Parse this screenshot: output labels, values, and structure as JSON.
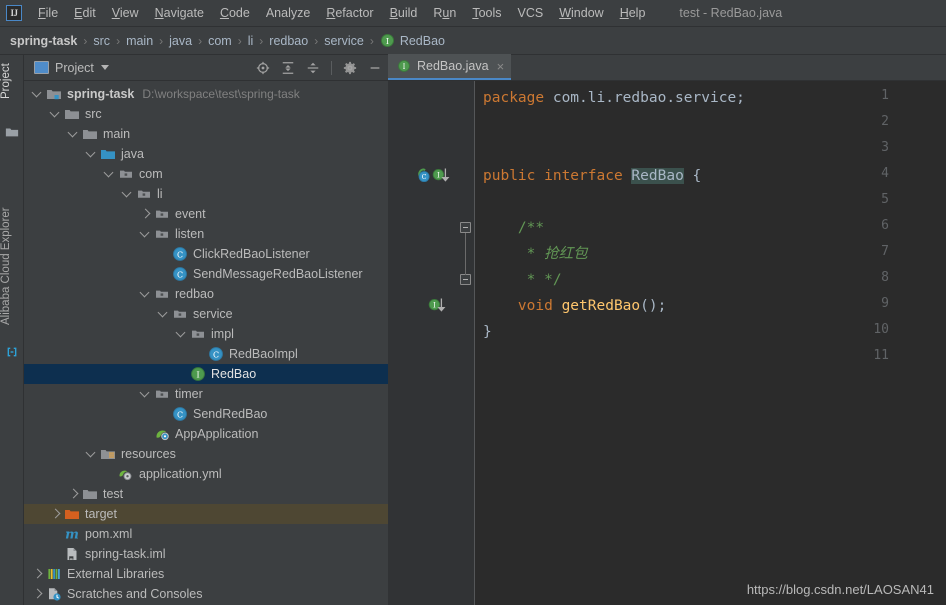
{
  "window": {
    "title": "test - RedBao.java",
    "logo_text": "IJ"
  },
  "menubar": {
    "items": [
      {
        "label": "File",
        "mnemonic": "F"
      },
      {
        "label": "Edit",
        "mnemonic": "E"
      },
      {
        "label": "View",
        "mnemonic": "V"
      },
      {
        "label": "Navigate",
        "mnemonic": "N"
      },
      {
        "label": "Code",
        "mnemonic": "C"
      },
      {
        "label": "Analyze",
        "mnemonic": ""
      },
      {
        "label": "Refactor",
        "mnemonic": "R"
      },
      {
        "label": "Build",
        "mnemonic": "B"
      },
      {
        "label": "Run",
        "mnemonic": "u"
      },
      {
        "label": "Tools",
        "mnemonic": "T"
      },
      {
        "label": "VCS",
        "mnemonic": ""
      },
      {
        "label": "Window",
        "mnemonic": "W"
      },
      {
        "label": "Help",
        "mnemonic": "H"
      }
    ]
  },
  "breadcrumb": {
    "separator": "›",
    "items": [
      {
        "label": "spring-task",
        "icon": "none",
        "root": true
      },
      {
        "label": "src",
        "icon": "none"
      },
      {
        "label": "main",
        "icon": "none"
      },
      {
        "label": "java",
        "icon": "none"
      },
      {
        "label": "com",
        "icon": "none"
      },
      {
        "label": "li",
        "icon": "none"
      },
      {
        "label": "redbao",
        "icon": "none"
      },
      {
        "label": "service",
        "icon": "none"
      },
      {
        "label": "RedBao",
        "icon": "interface-icon"
      }
    ]
  },
  "leftbar": {
    "tabs": [
      {
        "label": "Project",
        "icon": "project-folder-icon",
        "active": true
      },
      {
        "label": "Alibaba Cloud Explorer",
        "icon": "alibaba-cloud-icon",
        "active": false
      }
    ]
  },
  "project_panel": {
    "title": "Project",
    "title_icon": "project-view-icon",
    "dropdown_icon": "chevron-down-icon",
    "toolbar": [
      {
        "name": "scroll-from-source-icon",
        "title": "Select Opened File"
      },
      {
        "name": "expand-all-icon",
        "title": "Expand All"
      },
      {
        "name": "collapse-all-icon",
        "title": "Collapse All"
      },
      {
        "name": "settings-gear-icon",
        "title": "Settings"
      },
      {
        "name": "hide-panel-icon",
        "title": "Hide"
      }
    ],
    "tree": [
      {
        "label": "spring-task",
        "sublabel": "D:\\workspace\\test\\spring-task",
        "depth": 0,
        "arrow": "open",
        "icon": "module-icon",
        "bold": true,
        "state": "normal"
      },
      {
        "label": "src",
        "sublabel": "",
        "depth": 1,
        "arrow": "open",
        "icon": "folder-icon",
        "bold": false,
        "state": "normal"
      },
      {
        "label": "main",
        "sublabel": "",
        "depth": 2,
        "arrow": "open",
        "icon": "folder-icon",
        "bold": false,
        "state": "normal"
      },
      {
        "label": "java",
        "sublabel": "",
        "depth": 3,
        "arrow": "open",
        "icon": "source-root-icon",
        "bold": false,
        "state": "normal"
      },
      {
        "label": "com",
        "sublabel": "",
        "depth": 4,
        "arrow": "open",
        "icon": "package-icon",
        "bold": false,
        "state": "normal"
      },
      {
        "label": "li",
        "sublabel": "",
        "depth": 5,
        "arrow": "open",
        "icon": "package-icon",
        "bold": false,
        "state": "normal"
      },
      {
        "label": "event",
        "sublabel": "",
        "depth": 6,
        "arrow": "closed",
        "icon": "package-icon",
        "bold": false,
        "state": "normal"
      },
      {
        "label": "listen",
        "sublabel": "",
        "depth": 6,
        "arrow": "open",
        "icon": "package-icon",
        "bold": false,
        "state": "normal"
      },
      {
        "label": "ClickRedBaoListener",
        "sublabel": "",
        "depth": 7,
        "arrow": "none",
        "icon": "class-icon",
        "bold": false,
        "state": "normal"
      },
      {
        "label": "SendMessageRedBaoListener",
        "sublabel": "",
        "depth": 7,
        "arrow": "none",
        "icon": "class-icon",
        "bold": false,
        "state": "normal"
      },
      {
        "label": "redbao",
        "sublabel": "",
        "depth": 6,
        "arrow": "open",
        "icon": "package-icon",
        "bold": false,
        "state": "normal"
      },
      {
        "label": "service",
        "sublabel": "",
        "depth": 7,
        "arrow": "open",
        "icon": "package-icon",
        "bold": false,
        "state": "normal"
      },
      {
        "label": "impl",
        "sublabel": "",
        "depth": 8,
        "arrow": "open",
        "icon": "package-icon",
        "bold": false,
        "state": "normal"
      },
      {
        "label": "RedBaoImpl",
        "sublabel": "",
        "depth": 9,
        "arrow": "none",
        "icon": "class-icon",
        "bold": false,
        "state": "normal"
      },
      {
        "label": "RedBao",
        "sublabel": "",
        "depth": 8,
        "arrow": "none",
        "icon": "interface-icon",
        "bold": false,
        "state": "selected"
      },
      {
        "label": "timer",
        "sublabel": "",
        "depth": 6,
        "arrow": "open",
        "icon": "package-icon",
        "bold": false,
        "state": "normal"
      },
      {
        "label": "SendRedBao",
        "sublabel": "",
        "depth": 7,
        "arrow": "none",
        "icon": "class-icon",
        "bold": false,
        "state": "normal"
      },
      {
        "label": "AppApplication",
        "sublabel": "",
        "depth": 6,
        "arrow": "none",
        "icon": "spring-class-icon",
        "bold": false,
        "state": "normal"
      },
      {
        "label": "resources",
        "sublabel": "",
        "depth": 3,
        "arrow": "open",
        "icon": "resource-root-icon",
        "bold": false,
        "state": "normal"
      },
      {
        "label": "application.yml",
        "sublabel": "",
        "depth": 4,
        "arrow": "none",
        "icon": "spring-yml-icon",
        "bold": false,
        "state": "normal"
      },
      {
        "label": "test",
        "sublabel": "",
        "depth": 2,
        "arrow": "closed",
        "icon": "folder-icon",
        "bold": false,
        "state": "normal"
      },
      {
        "label": "target",
        "sublabel": "",
        "depth": 1,
        "arrow": "closed",
        "icon": "excluded-folder-icon",
        "bold": false,
        "state": "excluded"
      },
      {
        "label": "pom.xml",
        "sublabel": "",
        "depth": 1,
        "arrow": "none",
        "icon": "maven-icon",
        "bold": false,
        "state": "normal"
      },
      {
        "label": "spring-task.iml",
        "sublabel": "",
        "depth": 1,
        "arrow": "none",
        "icon": "iml-icon",
        "bold": false,
        "state": "normal"
      },
      {
        "label": "External Libraries",
        "sublabel": "",
        "depth": 0,
        "arrow": "closed",
        "icon": "libraries-icon",
        "bold": false,
        "state": "normal"
      },
      {
        "label": "Scratches and Consoles",
        "sublabel": "",
        "depth": 0,
        "arrow": "closed",
        "icon": "scratches-icon",
        "bold": false,
        "state": "normal"
      }
    ]
  },
  "editor": {
    "tabs": [
      {
        "label": "RedBao.java",
        "icon": "interface-icon",
        "close_glyph": "×",
        "active": true
      }
    ],
    "line_numbers": [
      "1",
      "2",
      "3",
      "4",
      "5",
      "6",
      "7",
      "8",
      "9",
      "10",
      "11"
    ],
    "lines": [
      {
        "n": "1",
        "tokens": [
          {
            "t": "package ",
            "c": "kw"
          },
          {
            "t": "com.li.redbao.service;",
            "c": "pn"
          }
        ]
      },
      {
        "n": "2",
        "tokens": []
      },
      {
        "n": "3",
        "tokens": []
      },
      {
        "n": "4",
        "tokens": [
          {
            "t": "public ",
            "c": "kw"
          },
          {
            "t": "interface ",
            "c": "kw"
          },
          {
            "t": "RedBao",
            "c": "hl"
          },
          {
            "t": " {",
            "c": "pn"
          }
        ]
      },
      {
        "n": "5",
        "tokens": []
      },
      {
        "n": "6",
        "tokens": [
          {
            "t": "    /**",
            "c": "cmt"
          }
        ]
      },
      {
        "n": "7",
        "tokens": [
          {
            "t": "     * ",
            "c": "cmt"
          },
          {
            "t": "抢红包",
            "c": "cmt-i"
          }
        ]
      },
      {
        "n": "8",
        "tokens": [
          {
            "t": "     * */",
            "c": "cmt"
          }
        ]
      },
      {
        "n": "9",
        "tokens": [
          {
            "t": "    void ",
            "c": "kw"
          },
          {
            "t": "getRedBao",
            "c": "mth"
          },
          {
            "t": "();",
            "c": "pn"
          }
        ]
      },
      {
        "n": "10",
        "tokens": [
          {
            "t": "}",
            "c": "pn"
          }
        ]
      },
      {
        "n": "11",
        "tokens": []
      }
    ],
    "gutter_markers": [
      {
        "line": "4",
        "icons": [
          "implemented-by-icon",
          "implementing-method-down-icon"
        ]
      },
      {
        "line": "9",
        "icons": [
          "implementing-method-down-icon"
        ]
      }
    ],
    "fold_markers": [
      {
        "line": "6",
        "type": "fold-start"
      },
      {
        "line": "8",
        "type": "fold-end"
      }
    ]
  },
  "watermark": {
    "text": "https://blog.csdn.net/LAOSAN41"
  },
  "colors": {
    "panel_bg": "#3c3f41",
    "editor_bg": "#2b2b2b",
    "gutter_bg": "#313335",
    "selection_bg": "#0d2f4f",
    "excluded_bg": "#4e4733",
    "accent_blue": "#4a88c7",
    "keyword_orange": "#cc7832",
    "comment_green": "#629755",
    "method_yellow": "#ffc66d",
    "text_default": "#a9b7c6"
  }
}
